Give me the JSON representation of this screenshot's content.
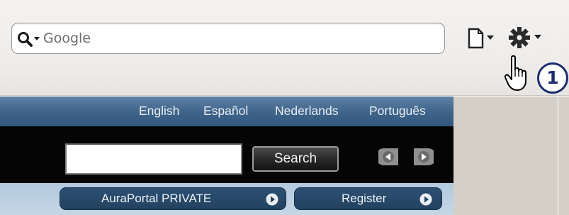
{
  "browser": {
    "search": {
      "placeholder": "Google",
      "engine_icon": "magnifier-dropdown-icon"
    },
    "page_menu_icon": "page-dropdown-icon",
    "tools_menu_icon": "gear-dropdown-icon",
    "cursor_icon": "hand-pointer-icon",
    "callout_number": "1"
  },
  "site": {
    "languages": [
      "English",
      "Español",
      "Nederlands",
      "Português"
    ],
    "search_button": "Search",
    "pager_icons": [
      "prev-arrow-icon",
      "next-arrow-icon"
    ],
    "buttons": {
      "private": "AuraPortal  PRIVATE",
      "register": "Register"
    }
  },
  "colors": {
    "language_bar": "#3e6389",
    "accent_navy": "#1c2d73",
    "button_pill": "#22425f"
  }
}
